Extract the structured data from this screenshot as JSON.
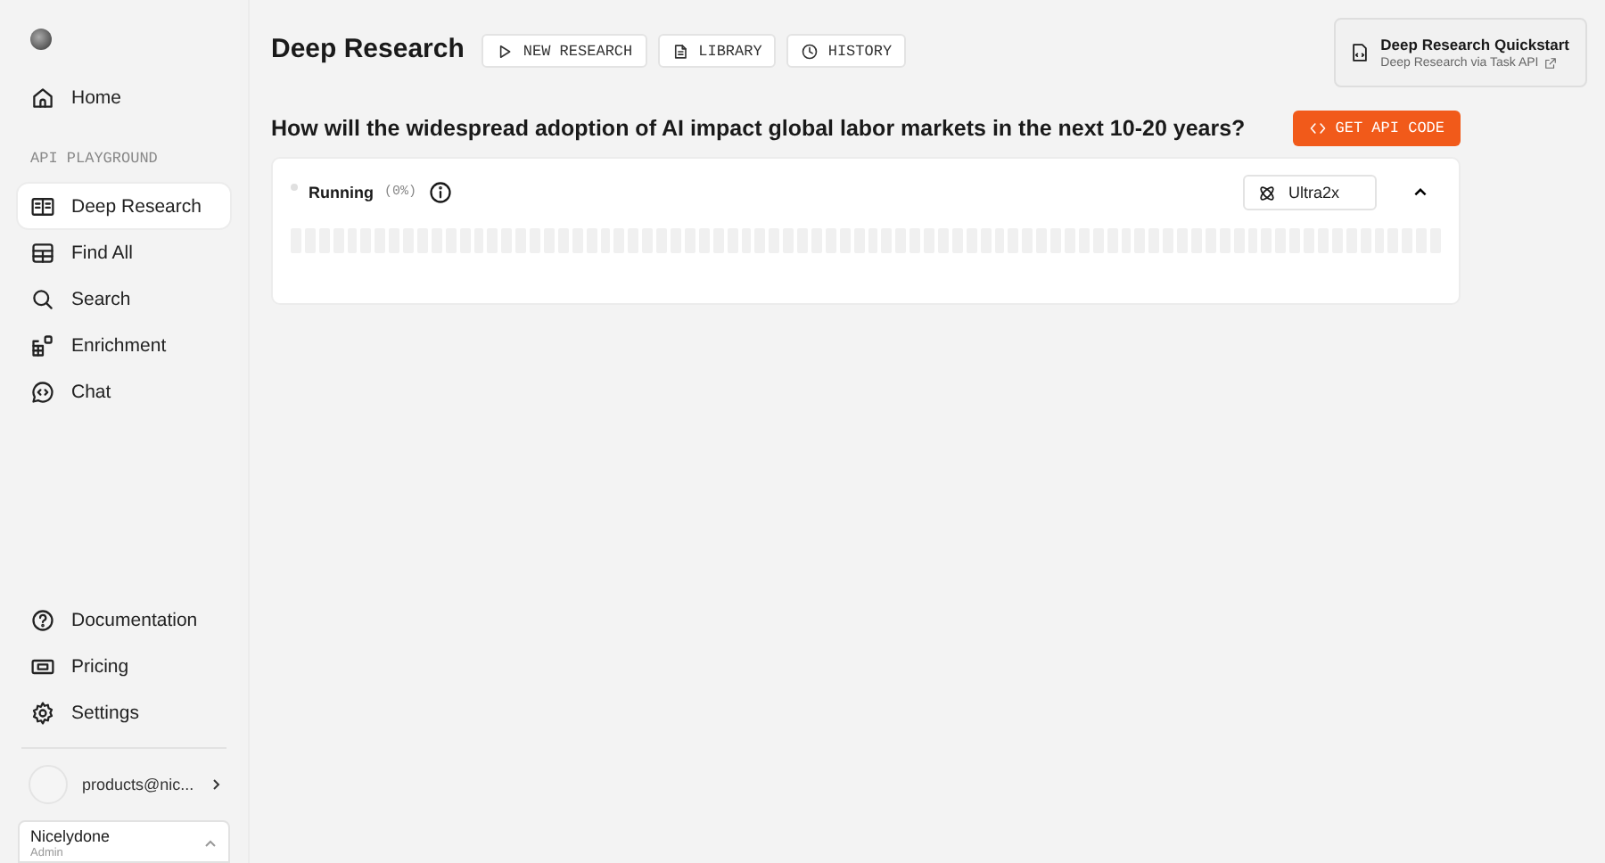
{
  "sidebar": {
    "nav": [
      {
        "label": "Home",
        "selected": false
      }
    ],
    "section_title": "API PLAYGROUND",
    "items": [
      {
        "label": "Deep Research",
        "selected": true
      },
      {
        "label": "Find All",
        "selected": false
      },
      {
        "label": "Search",
        "selected": false
      },
      {
        "label": "Enrichment",
        "selected": false
      },
      {
        "label": "Chat",
        "selected": false
      }
    ],
    "footer_items": [
      {
        "label": "Documentation",
        "selected": false
      },
      {
        "label": "Pricing",
        "selected": false
      },
      {
        "label": "Settings",
        "selected": false
      }
    ],
    "account": {
      "email": "products@nic..."
    },
    "org": {
      "name": "Nicelydone",
      "role": "Admin"
    }
  },
  "header": {
    "title": "Deep Research",
    "buttons": [
      "NEW RESEARCH",
      "LIBRARY",
      "HISTORY"
    ],
    "quickstart": {
      "title": "Deep Research Quickstart",
      "subtitle": "Deep Research via Task API"
    }
  },
  "question": "How will the widespread adoption of AI impact global labor markets in the next 10-20 years?",
  "api_button": "GET API CODE",
  "task": {
    "status": "Running",
    "percent": "(0%)",
    "processor": "Ultra2x",
    "expanded": true
  }
}
